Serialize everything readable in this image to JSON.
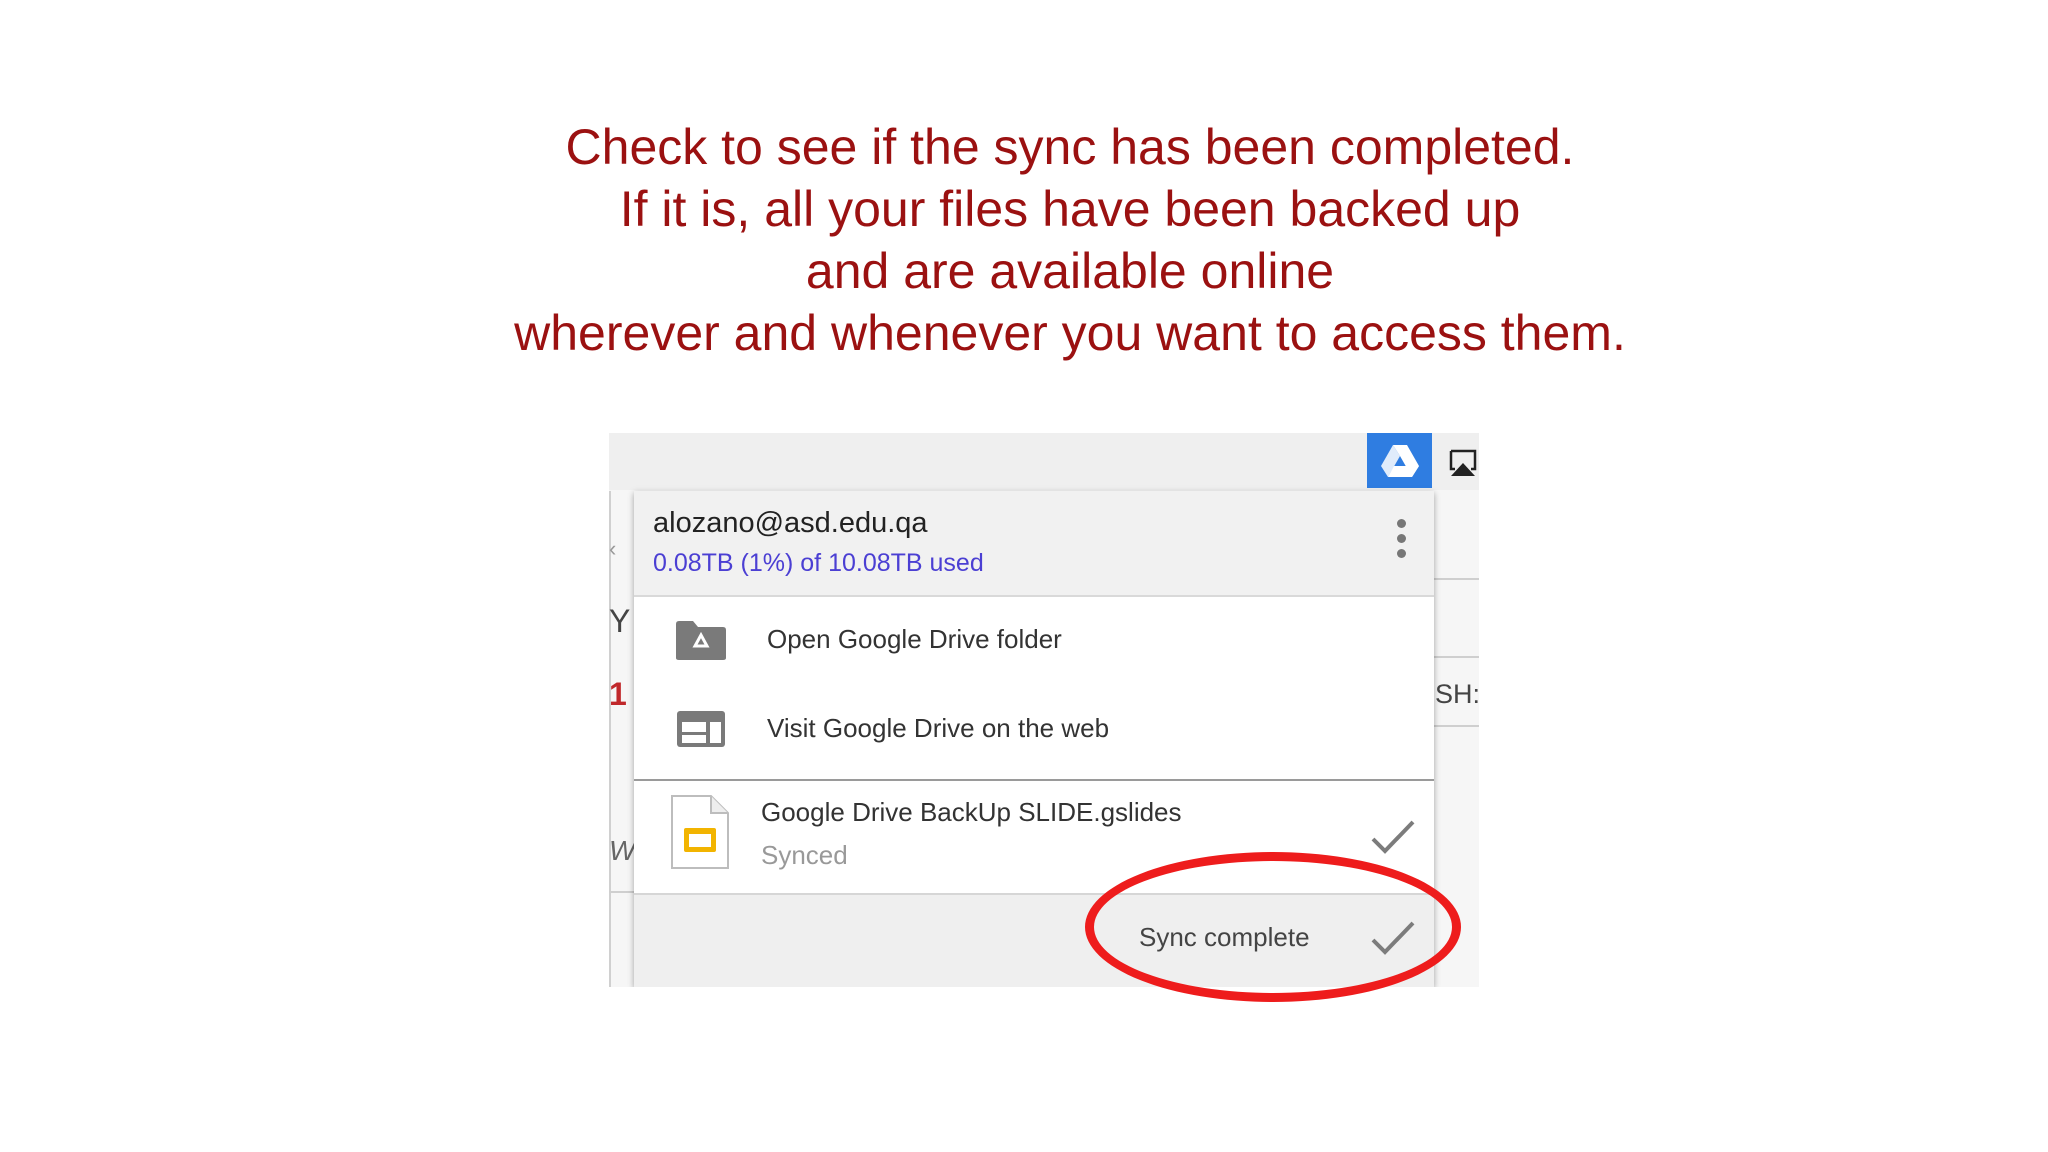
{
  "caption": {
    "line1": "Check to see if the sync has been completed.",
    "line2": "If it is, all your files have been backed up",
    "line3": "and are available online",
    "line4": "wherever and whenever you want to access them."
  },
  "colors": {
    "caption": "#9b1111",
    "drive_button": "#2f7de1",
    "usage_text": "#4b3fd3",
    "highlight_ring": "#ee1c1c"
  },
  "background_fragments": {
    "left_1": "Y",
    "left_2": "1",
    "left_3": "Wa",
    "right_1": "SH:"
  },
  "toolbar": {
    "drive_icon": "google-drive-icon",
    "airplay_icon": "airplay-icon"
  },
  "account": {
    "email": "alozano@asd.edu.qa",
    "usage": "0.08TB (1%) of 10.08TB used"
  },
  "menu": {
    "items": [
      {
        "label": "Open Google Drive folder",
        "icon": "drive-folder-icon"
      },
      {
        "label": "Visit Google Drive on the web",
        "icon": "browser-window-icon"
      }
    ]
  },
  "recent_file": {
    "name": "Google Drive BackUp SLIDE.gslides",
    "status": "Synced",
    "icon": "google-slides-file-icon"
  },
  "footer": {
    "status": "Sync complete"
  }
}
